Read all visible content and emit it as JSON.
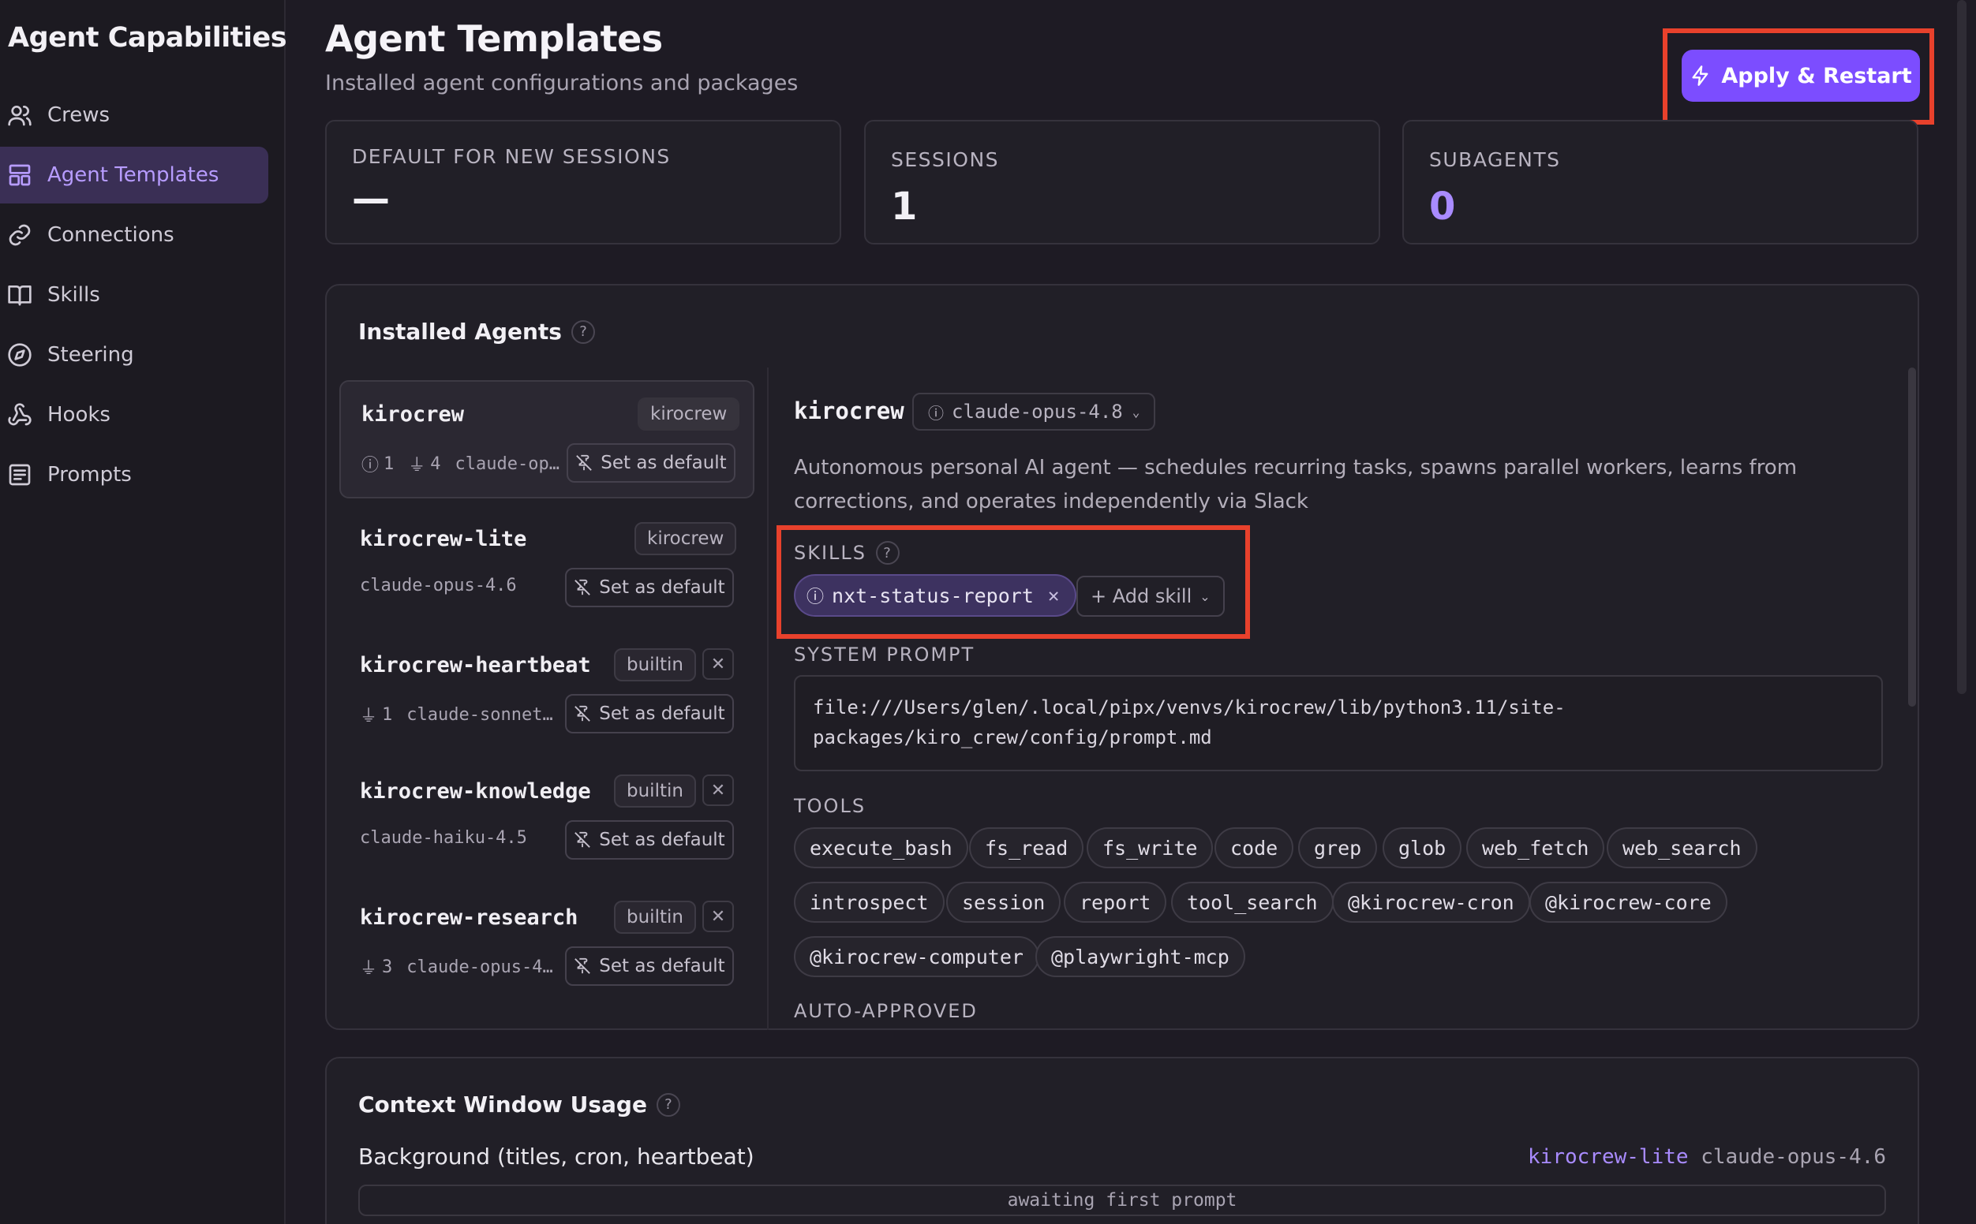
{
  "sidebar": {
    "title": "Agent Capabilities",
    "items": [
      {
        "label": "Crews",
        "icon": "users-icon"
      },
      {
        "label": "Agent Templates",
        "icon": "layout-icon",
        "active": true
      },
      {
        "label": "Connections",
        "icon": "link-icon"
      },
      {
        "label": "Skills",
        "icon": "book-icon"
      },
      {
        "label": "Steering",
        "icon": "compass-icon"
      },
      {
        "label": "Hooks",
        "icon": "webhook-icon"
      },
      {
        "label": "Prompts",
        "icon": "message-icon"
      }
    ]
  },
  "header": {
    "title": "Agent Templates",
    "subtitle": "Installed agent configurations and packages",
    "apply_label": "Apply & Restart"
  },
  "stats": [
    {
      "label": "DEFAULT FOR NEW SESSIONS",
      "value": "—"
    },
    {
      "label": "SESSIONS",
      "value": "1"
    },
    {
      "label": "SUBAGENTS",
      "value": "0"
    }
  ],
  "installed": {
    "title": "Installed Agents",
    "help": "?",
    "set_default_label": "Set as default",
    "agents": [
      {
        "name": "kirocrew",
        "tag": "kirocrew",
        "meta": [
          "1",
          "4",
          "claude-op…"
        ],
        "selected": true
      },
      {
        "name": "kirocrew-lite",
        "tag": "kirocrew",
        "meta": [
          "claude-opus-4.6"
        ]
      },
      {
        "name": "kirocrew-heartbeat",
        "tag": "builtin",
        "meta": [
          "1",
          "claude-sonnet…"
        ]
      },
      {
        "name": "kirocrew-knowledge",
        "tag": "builtin",
        "meta": [
          "claude-haiku-4.5"
        ]
      },
      {
        "name": "kirocrew-research",
        "tag": "builtin",
        "meta": [
          "3",
          "claude-opus-4…"
        ]
      }
    ]
  },
  "detail": {
    "name": "kirocrew",
    "model": "claude-opus-4.8",
    "description": "Autonomous personal AI agent — schedules recurring tasks, spawns parallel workers, learns from corrections, and operates independently via Slack",
    "skills_label": "SKILLS",
    "skills": [
      "nxt-status-report"
    ],
    "add_skill_label": "+ Add skill",
    "system_prompt_label": "SYSTEM PROMPT",
    "system_prompt_line1": "file:///Users/glen/.local/pipx/venvs/kirocrew/lib/python3.11/site-",
    "system_prompt_line2": "packages/kiro_crew/config/prompt.md",
    "tools_label": "TOOLS",
    "tools": [
      "execute_bash",
      "fs_read",
      "fs_write",
      "code",
      "grep",
      "glob",
      "web_fetch",
      "web_search",
      "introspect",
      "session",
      "report",
      "tool_search",
      "@kirocrew-cron",
      "@kirocrew-core",
      "@kirocrew-computer",
      "@playwright-mcp"
    ],
    "auto_approved_label": "AUTO-APPROVED"
  },
  "context": {
    "title": "Context Window Usage",
    "help": "?",
    "row_label": "Background (titles, cron, heartbeat)",
    "row_agent": "kirocrew-lite",
    "row_model": "claude-opus-4.6",
    "status": "awaiting first prompt"
  },
  "colors": {
    "accent": "#7c4dff",
    "accent_text": "#a98bff",
    "highlight": "#e8412c",
    "background": "#1e1b24"
  }
}
